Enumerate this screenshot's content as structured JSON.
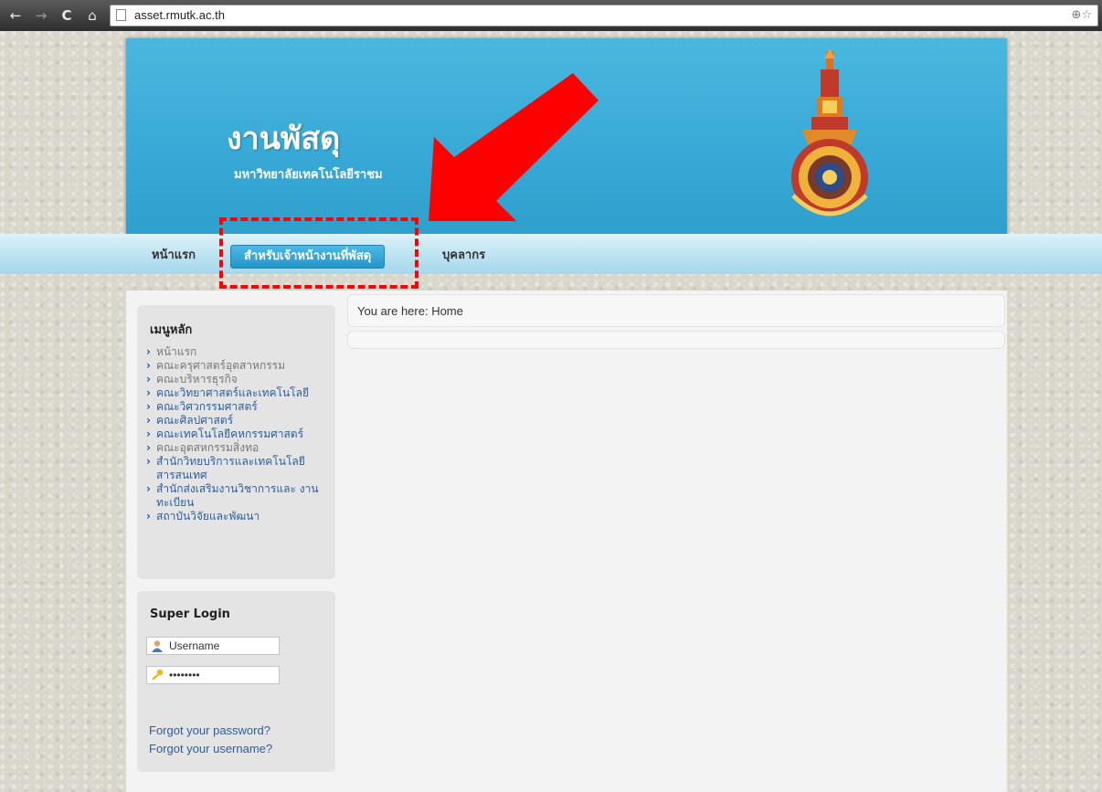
{
  "browser": {
    "url": "asset.rmutk.ac.th",
    "back_glyph": "←",
    "forward_glyph": "→",
    "reload_glyph": "C",
    "home_glyph": "⌂",
    "zoom_glyph": "⊕☆"
  },
  "header": {
    "title": "งานพัสดุ",
    "subtitle": "มหาวิทยาลัยเทคโนโลยีราชม"
  },
  "nav": {
    "items": [
      {
        "label": "หน้าแรก"
      },
      {
        "label": "สำหรับเจ้าหน้างานที่พัสดุ"
      },
      {
        "label": "บุคลากร"
      }
    ]
  },
  "main_menu": {
    "title": "เมนูหลัก",
    "items": [
      {
        "label": "หน้าแรก"
      },
      {
        "label": "คณะครุศาสตร์อุตสาหกรรม"
      },
      {
        "label": "คณะบริหารธุรกิจ"
      },
      {
        "label": "คณะวิทยาศาสตร์และเทคโนโลยี"
      },
      {
        "label": "คณะวิศวกรรมศาสตร์"
      },
      {
        "label": "คณะศิลปศาสตร์"
      },
      {
        "label": "คณะเทคโนโลยีคหกรรมศาสตร์"
      },
      {
        "label": "คณะอุตสหกรรมสิ่งทอ"
      },
      {
        "label": "สำนักวิทยบริการและเทคโนโลยี สารสนเทศ"
      },
      {
        "label": "สำนักส่งเสริมงานวิชาการและ งานทะเบียน"
      },
      {
        "label": "สถาบันวิจัยและพัฒนา"
      }
    ]
  },
  "login": {
    "title": "Super Login",
    "username_value": "Username",
    "password_value": "••••••••",
    "forgot_password": "Forgot your password?",
    "forgot_username": "Forgot your username?"
  },
  "breadcrumb": {
    "text": "You are here: Home"
  },
  "colors": {
    "banner": "#38a9d6",
    "annotation": "#ff0000",
    "active_menu": "#2696c8"
  }
}
